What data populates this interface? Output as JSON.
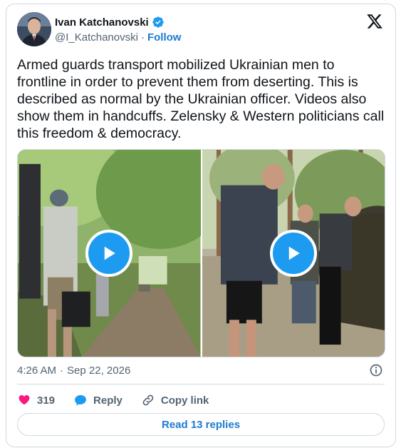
{
  "author": {
    "name": "Ivan Katchanovski",
    "handle": "@I_Katchanovski",
    "separator": "·",
    "follow_label": "Follow"
  },
  "tweet": {
    "text": "Armed guards transport mobilized Ukrainian men to frontline in order to prevent them from deserting. This is described as normal by the Ukrainian officer. Videos also show them in handcuffs. Zelensky & Western politicians call this freedom & democracy."
  },
  "media": {
    "videos": [
      {
        "icon": "play-icon"
      },
      {
        "icon": "play-icon"
      }
    ]
  },
  "meta": {
    "time": "4:26 AM",
    "separator": "·",
    "date": "Sep 22, 2026"
  },
  "actions": {
    "like_count": "319",
    "reply_label": "Reply",
    "copy_label": "Copy link"
  },
  "read_replies_label": "Read 13 replies",
  "colors": {
    "accent": "#1d9bf0",
    "link": "#1d7bd1",
    "like": "#f91880",
    "secondary_text": "#536471",
    "border": "#cfd9de"
  }
}
